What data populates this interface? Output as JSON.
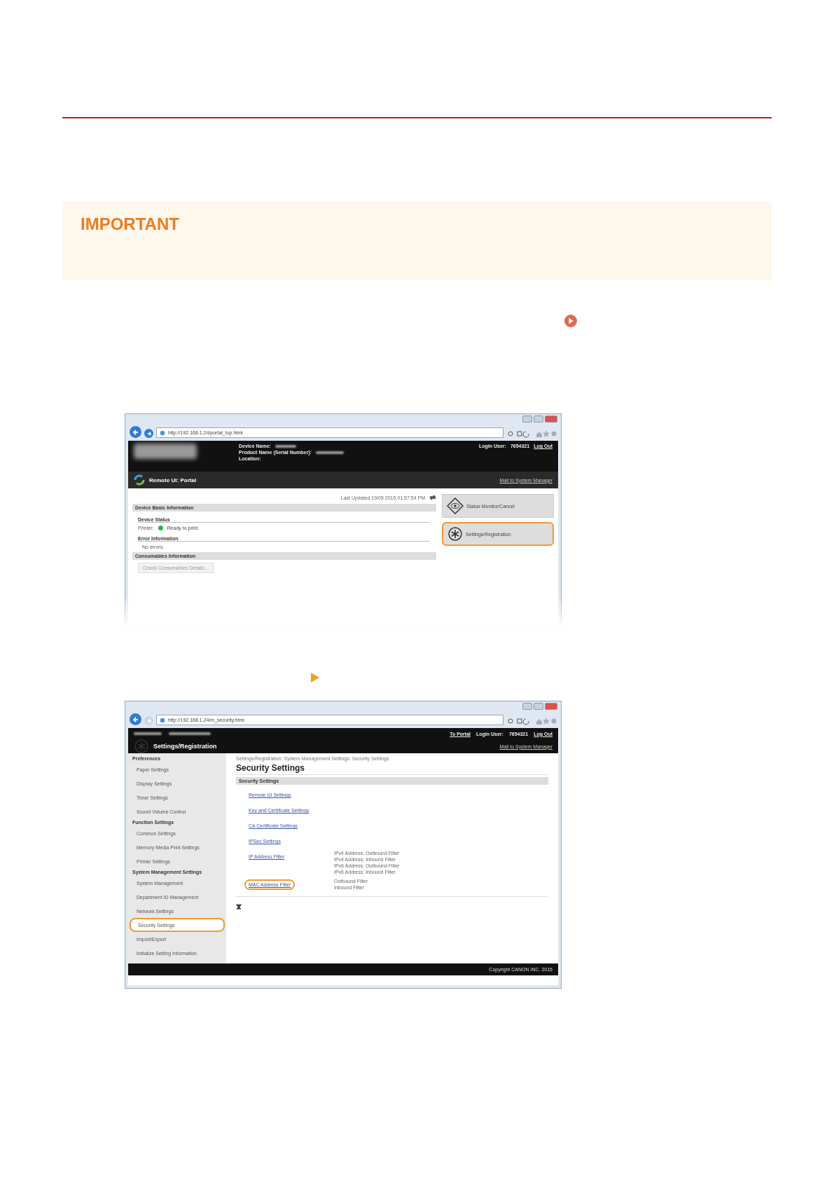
{
  "important": {
    "title": "IMPORTANT"
  },
  "portal": {
    "url": "http://192.168.1.24/portal_top.html",
    "header_labels": [
      "Device Name:",
      "Product Name (Serial Number):",
      "Location:"
    ],
    "login_label": "Login User:",
    "login_value": "7654321",
    "logout": "Log Out",
    "title": "Remote UI: Portal",
    "mail": "Mail to System Manager",
    "last_updated": "Last Updated:19/05 2015 01:57:54 PM",
    "sections": [
      {
        "title": "Device Basic Information",
        "groups": [
          {
            "title": "Device Status",
            "lines": [
              {
                "kind": "status",
                "label": "Printer:",
                "value": "Ready to print.",
                "color": "#2cb34a"
              }
            ]
          },
          {
            "title": "Error Information",
            "lines": [
              {
                "kind": "plain",
                "value": "No errors."
              }
            ]
          }
        ]
      },
      {
        "title": "Consumables Information",
        "button": "Check Consumables Details..."
      }
    ],
    "side_buttons": [
      {
        "kind": "eye",
        "label": "Status Monitor/Cancel",
        "highlighted": false
      },
      {
        "kind": "gear",
        "label": "Settings/Registration",
        "highlighted": true
      }
    ]
  },
  "settings": {
    "url": "http://192.168.1.24/m_security.html",
    "to_portal": "To Portal",
    "login_label": "Login User:",
    "login_value": "7654321",
    "logout": "Log Out",
    "title": "Settings/Registration",
    "mail": "Mail to System Manager",
    "sidebar": [
      {
        "title": "Preferences",
        "items": [
          {
            "label": "Paper Settings",
            "highlighted": false
          },
          {
            "label": "Display Settings",
            "highlighted": false
          },
          {
            "label": "Timer Settings",
            "highlighted": false
          },
          {
            "label": "Sound Volume Control",
            "highlighted": false
          }
        ]
      },
      {
        "title": "Function Settings",
        "items": [
          {
            "label": "Common Settings",
            "highlighted": false
          },
          {
            "label": "Memory Media Print Settings",
            "highlighted": false
          },
          {
            "label": "Printer Settings",
            "highlighted": false
          }
        ]
      },
      {
        "title": "System Management Settings",
        "items": [
          {
            "label": "System Management",
            "highlighted": false
          },
          {
            "label": "Department ID Management",
            "highlighted": false
          },
          {
            "label": "Network Settings",
            "highlighted": false
          },
          {
            "label": "Security Settings",
            "highlighted": true
          },
          {
            "label": "Import/Export",
            "highlighted": false
          },
          {
            "label": "Initialize Setting Information",
            "highlighted": false
          }
        ]
      }
    ],
    "breadcrumb": "Settings/Registration: System Management Settings: Security Settings",
    "heading": "Security Settings",
    "section": "Security Settings",
    "links": [
      {
        "label": "Remote UI Settings",
        "highlighted": false
      },
      {
        "label": "Key and Certificate Settings",
        "highlighted": false
      },
      {
        "label": "CA Certificate Settings",
        "highlighted": false
      },
      {
        "label": "IPSec Settings",
        "highlighted": false
      },
      {
        "label": "IP Address Filter",
        "highlighted": false,
        "notes": [
          "IPv4 Address: Outbound Filter",
          "IPv4 Address: Inbound Filter",
          "IPv6 Address: Outbound Filter",
          "IPv6 Address: Inbound Filter"
        ]
      },
      {
        "label": "MAC Address Filter",
        "highlighted": true,
        "notes": [
          "Outbound Filter",
          "Inbound Filter"
        ]
      }
    ],
    "copyright": "Copyright CANON INC. 2015"
  }
}
